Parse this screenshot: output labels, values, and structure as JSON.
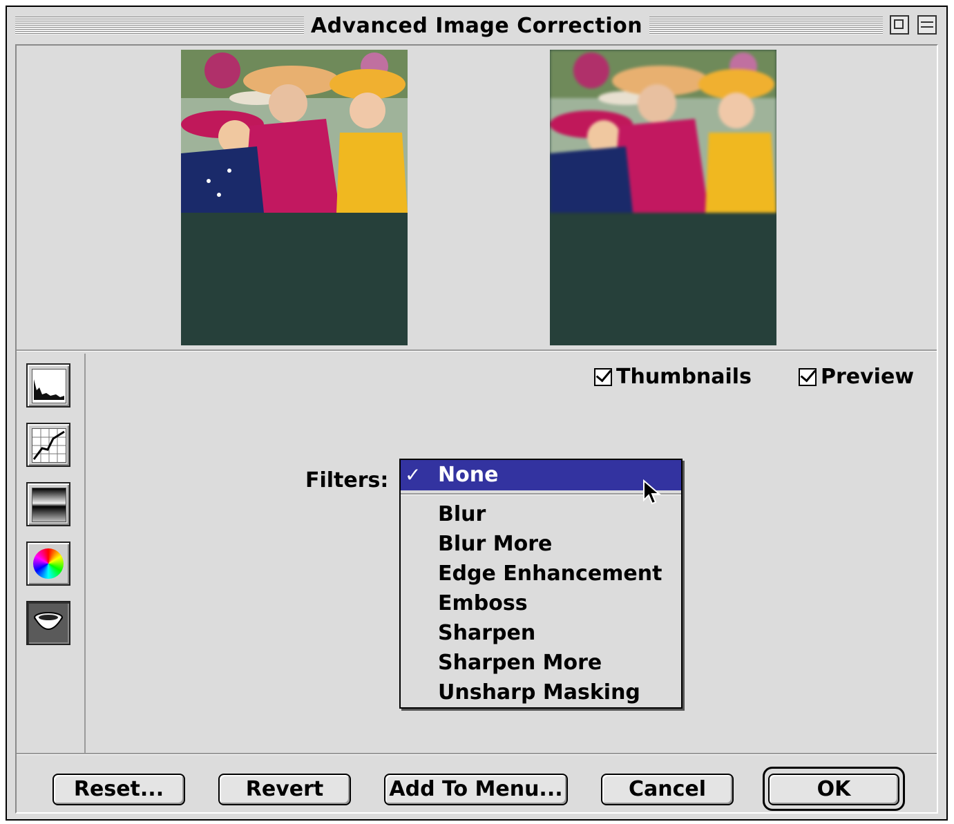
{
  "window": {
    "title": "Advanced Image Correction"
  },
  "options": {
    "thumbnails_label": "Thumbnails",
    "thumbnails_checked": true,
    "preview_label": "Preview",
    "preview_checked": true
  },
  "filters": {
    "label": "Filters:",
    "selected": "None",
    "check_mark": "✓",
    "options": [
      "Blur",
      "Blur More",
      "Edge Enhancement",
      "Emboss",
      "Sharpen",
      "Sharpen More",
      "Unsharp Masking"
    ]
  },
  "buttons": {
    "reset": "Reset...",
    "revert": "Revert",
    "add_to_menu": "Add To Menu...",
    "cancel": "Cancel",
    "ok": "OK"
  },
  "tools": [
    "histogram-tool-icon",
    "curves-tool-icon",
    "gradient-tool-icon",
    "color-wheel-tool-icon",
    "bowl-tool-icon"
  ],
  "colors": {
    "menu_highlight": "#3333a0",
    "thumbnail_background": "#26403a",
    "window_background": "#dcdcdc"
  }
}
